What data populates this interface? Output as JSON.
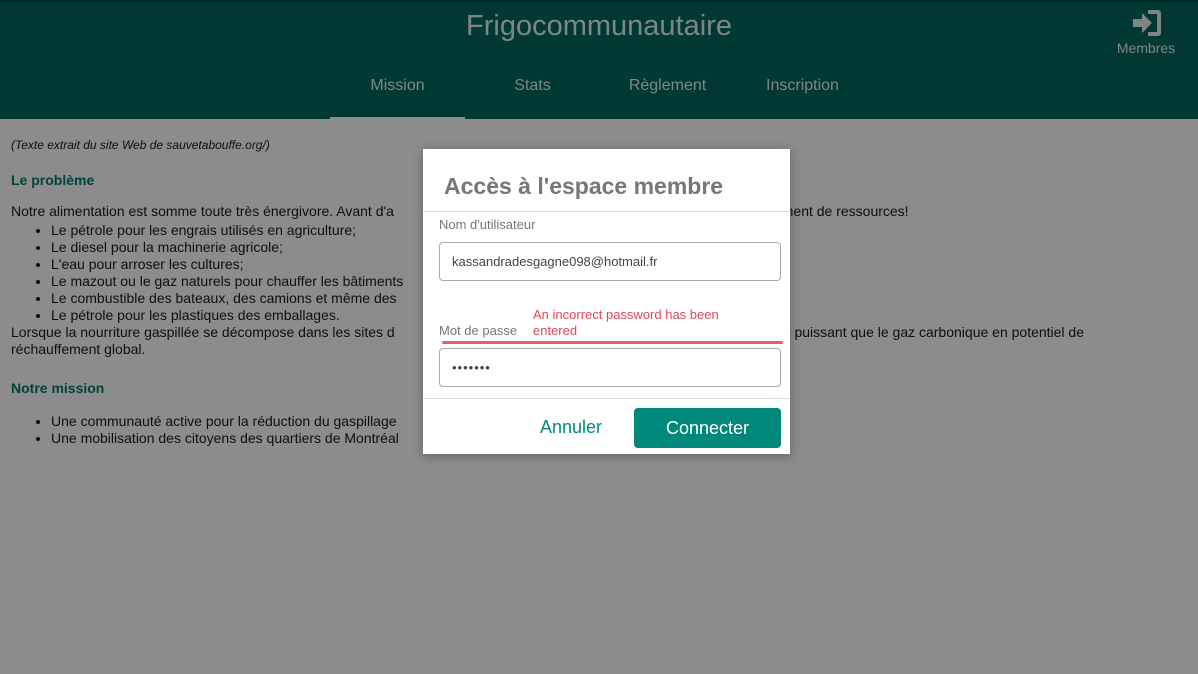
{
  "header": {
    "title": "Frigocommunautaire",
    "members_label": "Membres",
    "members_icon": "sign-in-icon"
  },
  "nav": {
    "tabs": [
      {
        "label": "Mission",
        "active": true
      },
      {
        "label": "Stats",
        "active": false
      },
      {
        "label": "Règlement",
        "active": false
      },
      {
        "label": "Inscription",
        "active": false
      }
    ]
  },
  "content": {
    "caption": "(Texte extrait du site Web de sauvetabouffe.org/)",
    "problem_title": "Le problème",
    "problem_intro_start": "Notre alimentation est somme toute très énergivore. Avant d'a",
    "problem_intro_end": "ement de ressources!",
    "problem_items": [
      "Le pétrole pour les engrais utilisés en agriculture;",
      "Le diesel pour la machinerie agricole;",
      "L'eau pour arroser les cultures;",
      "Le mazout ou le gaz naturels pour chauffer les bâtiments",
      "Le combustible des bateaux, des camions et même des",
      "Le pétrole pour  les plastiques des emballages."
    ],
    "decomp_start": "Lorsque la nourriture gaspillée se décompose dans les sites d",
    "decomp_end": "lus puissant que le gaz carbonique en potentiel de",
    "decomp_line2": "réchauffement global.",
    "mission_title": "Notre mission",
    "mission_items": [
      "Une communauté active pour la réduction du gaspillage",
      "Une mobilisation des citoyens des quartiers de Montréal"
    ]
  },
  "modal": {
    "title": "Accès à l'espace membre",
    "username_label": "Nom d'utilisateur",
    "username_value": "kassandradesgagne098@hotmail.fr",
    "password_label": "Mot de passe",
    "password_value": "•••••••",
    "error_message": "An incorrect password has been entered",
    "cancel_label": "Annuler",
    "connect_label": "Connecter"
  },
  "colors": {
    "header_bg": "#00695f",
    "accent": "#00897b",
    "error": "#e0455a"
  }
}
